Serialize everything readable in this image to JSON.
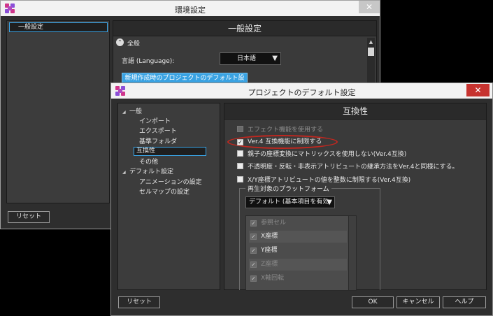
{
  "back_window": {
    "title": "環境設定",
    "close_glyph": "✕",
    "sidebar_items": [
      "一般設定"
    ],
    "reset_label": "リセット",
    "header": "一般設定",
    "section_label": "全般",
    "language_label": "言語 (Language):",
    "language_value": "日本語",
    "project_defaults_button": "新規作成時のプロジェクトのデフォルト設定"
  },
  "dialog": {
    "title": "プロジェクトのデフォルト設定",
    "close_glyph": "✕",
    "tree": [
      {
        "label": "一般",
        "expander": "◢"
      },
      {
        "label": "インポート"
      },
      {
        "label": "エクスポート"
      },
      {
        "label": "基準フォルダ"
      },
      {
        "label": "互換性"
      },
      {
        "label": "その他"
      },
      {
        "label": "デフォルト設定",
        "expander": "◢"
      },
      {
        "label": "アニメーションの設定"
      },
      {
        "label": "セルマップの設定"
      }
    ],
    "selected_tree_item": "互換性",
    "reset_label": "リセット",
    "content_header": "互換性",
    "options": [
      {
        "label": "エフェクト機能を使用する",
        "checked": false,
        "enabled": false
      },
      {
        "label": "Ver.4 互換機能に制限する",
        "checked": true,
        "enabled": true
      },
      {
        "label": "親子の座標変換にマトリックスを使用しない(Ver.4互換)",
        "checked": false,
        "enabled": true
      },
      {
        "label": "不透明度・反転・非表示アトリビュートの継承方法をVer.4と同様にする。",
        "checked": false,
        "enabled": true
      },
      {
        "label": "X/Y座標アトリビュートの値を整数に制限する(Ver.4互換)",
        "checked": false,
        "enabled": true
      }
    ],
    "platform": {
      "group_label": "再生対象のプラットフォーム",
      "selected": "デフォルト (基本項目を有効",
      "attributes": [
        {
          "label": "参照セル",
          "checked": true,
          "enabled": false
        },
        {
          "label": "X座標",
          "checked": true,
          "enabled": true
        },
        {
          "label": "Y座標",
          "checked": true,
          "enabled": true
        },
        {
          "label": "Z座標",
          "checked": true,
          "enabled": false
        },
        {
          "label": "X軸回転",
          "checked": true,
          "enabled": false
        }
      ]
    },
    "buttons": {
      "ok": "OK",
      "cancel": "キャンセル",
      "help": "ヘルプ"
    },
    "check_glyph": "✓",
    "caret_glyph": "▼",
    "section_glyph": "⌃"
  },
  "colors": {
    "accent": "#39a2e2",
    "highlight_ring": "#c0271f",
    "panel_bg": "#3a3a3a"
  }
}
